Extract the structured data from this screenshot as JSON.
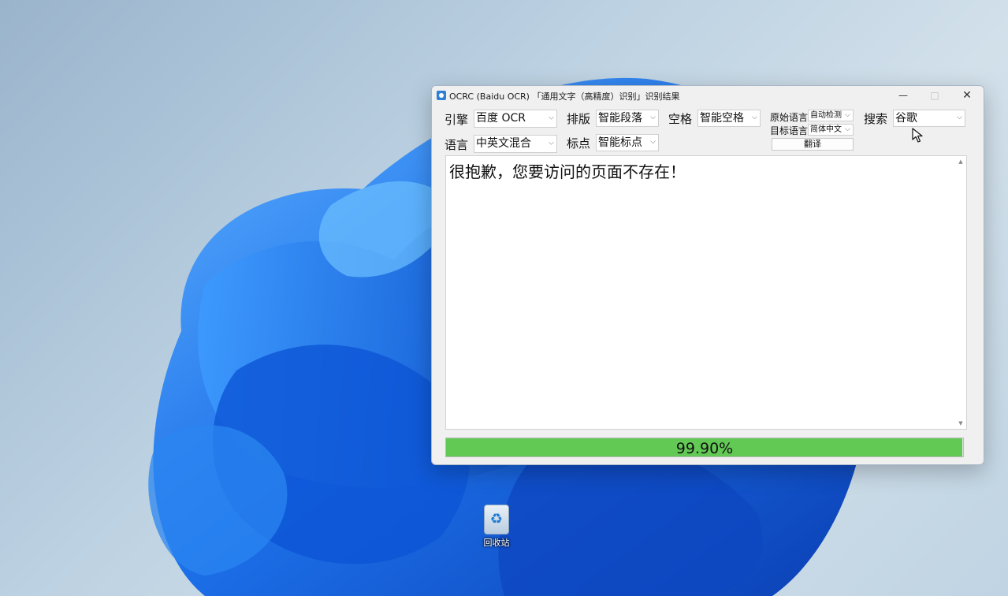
{
  "window": {
    "title": "OCRC (Baidu OCR) 「通用文字（高精度）识别」识别结果",
    "minimize": "—",
    "maximize": "□",
    "close": "✕"
  },
  "options": {
    "engine_label": "引擎",
    "engine_value": "百度 OCR",
    "layout_label": "排版",
    "layout_value": "智能段落",
    "space_label": "空格",
    "space_value": "智能空格",
    "language_label": "语言",
    "language_value": "中英文混合",
    "punct_label": "标点",
    "punct_value": "智能标点"
  },
  "translate": {
    "source_label": "原始语言",
    "source_value": "自动检测",
    "target_label": "目标语言",
    "target_value": "简体中文",
    "button": "翻译"
  },
  "search": {
    "label": "搜索",
    "value": "谷歌"
  },
  "result": {
    "text": "很抱歉，您要访问的页面不存在！"
  },
  "progress": {
    "label": "99.90%",
    "value": 0.999,
    "color": "#63c955"
  },
  "desktop": {
    "recycle_bin_label": "回收站"
  },
  "icons": [
    "app-icon",
    "dropdown-arrow-icon",
    "recycle-bin-icon",
    "mouse-cursor-icon",
    "scroll-up-icon",
    "scroll-down-icon"
  ]
}
